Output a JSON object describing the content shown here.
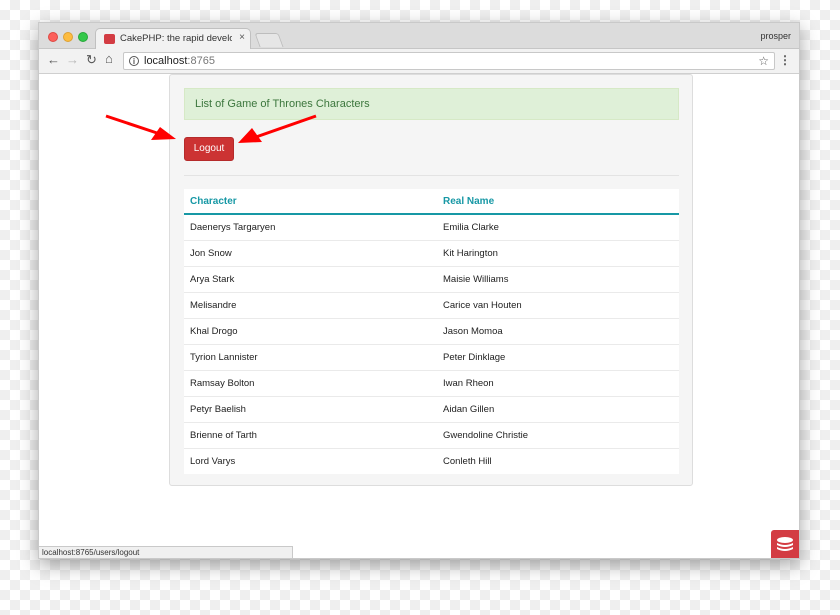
{
  "browser": {
    "tab_title": "CakePHP: the rapid developme",
    "tab_close": "×",
    "profile_name": "prosper",
    "address_host": "localhost",
    "address_port": ":8765",
    "status_url": "localhost:8765/users/logout"
  },
  "page": {
    "alert_text": "List of Game of Thrones Characters",
    "logout_label": "Logout",
    "table": {
      "headers": [
        "Character",
        "Real Name"
      ],
      "rows": [
        [
          "Daenerys Targaryen",
          "Emilia Clarke"
        ],
        [
          "Jon Snow",
          "Kit Harington"
        ],
        [
          "Arya Stark",
          "Maisie Williams"
        ],
        [
          "Melisandre",
          "Carice van Houten"
        ],
        [
          "Khal Drogo",
          "Jason Momoa"
        ],
        [
          "Tyrion Lannister",
          "Peter Dinklage"
        ],
        [
          "Ramsay Bolton",
          "Iwan Rheon"
        ],
        [
          "Petyr Baelish",
          "Aidan Gillen"
        ],
        [
          "Brienne of Tarth",
          "Gwendoline Christie"
        ],
        [
          "Lord Varys",
          "Conleth Hill"
        ]
      ]
    }
  },
  "icons": {
    "back": "back-arrow-icon",
    "forward": "forward-arrow-icon",
    "reload": "reload-icon",
    "home": "home-icon",
    "info": "info-icon",
    "star": "star-icon",
    "menu": "kebab-menu-icon",
    "logo": "cakephp-logo"
  },
  "colors": {
    "accent": "#1798a5",
    "danger": "#cc3333",
    "success_bg": "#dff0d8",
    "success_text": "#3c763d",
    "annotation_arrow": "#ff0000"
  }
}
